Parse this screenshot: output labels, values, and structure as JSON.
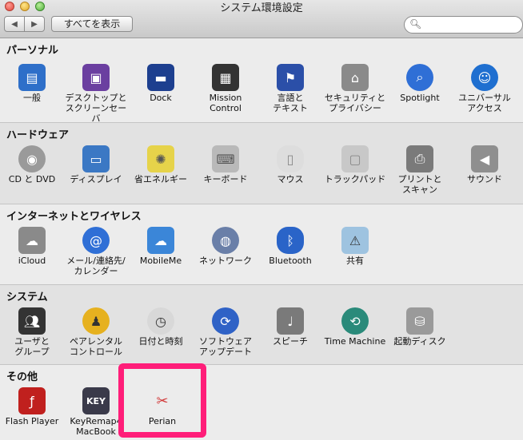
{
  "window": {
    "title": "システム環境設定"
  },
  "toolbar": {
    "back": "◀",
    "forward": "▶",
    "show_all": "すべてを表示",
    "search_placeholder": ""
  },
  "sections": [
    {
      "title": "パーソナル",
      "items": [
        {
          "label": "一般",
          "icon": "file-icon",
          "color": "#2e6fc9"
        },
        {
          "label": "デスクトップと\nスクリーンセーバ",
          "icon": "desktop-icon",
          "color": "#6b3fa0"
        },
        {
          "label": "Dock",
          "icon": "dock-icon",
          "color": "#1d3f8f"
        },
        {
          "label": "Mission\nControl",
          "icon": "mission-control-icon",
          "color": "#333333"
        },
        {
          "label": "言語と\nテキスト",
          "icon": "flag-icon",
          "color": "#2b4fa8"
        },
        {
          "label": "セキュリティと\nプライバシー",
          "icon": "house-lock-icon",
          "color": "#8a8a8a"
        },
        {
          "label": "Spotlight",
          "icon": "spotlight-icon",
          "color": "#2f6fd6"
        },
        {
          "label": "ユニバーサル\nアクセス",
          "icon": "accessibility-icon",
          "color": "#1f6fd0"
        }
      ]
    },
    {
      "title": "ハードウェア",
      "items": [
        {
          "label": "CD と DVD",
          "icon": "disc-icon",
          "color": "#9a9a9a"
        },
        {
          "label": "ディスプレイ",
          "icon": "display-icon",
          "color": "#3b78c4"
        },
        {
          "label": "省エネルギー",
          "icon": "bulb-icon",
          "color": "#e6d34a"
        },
        {
          "label": "キーボード",
          "icon": "keyboard-icon",
          "color": "#b9b9b9"
        },
        {
          "label": "マウス",
          "icon": "mouse-icon",
          "color": "#dddddd"
        },
        {
          "label": "トラックパッド",
          "icon": "trackpad-icon",
          "color": "#c8c8c8"
        },
        {
          "label": "プリントと\nスキャン",
          "icon": "printer-icon",
          "color": "#7a7a7a"
        },
        {
          "label": "サウンド",
          "icon": "speaker-icon",
          "color": "#8f8f8f"
        }
      ]
    },
    {
      "title": "インターネットとワイヤレス",
      "items": [
        {
          "label": "iCloud",
          "icon": "cloud-icon",
          "color": "#8a8a8a"
        },
        {
          "label": "メール/連絡先/\nカレンダー",
          "icon": "at-icon",
          "color": "#2f6fd6"
        },
        {
          "label": "MobileMe",
          "icon": "cloud-icon",
          "color": "#3b86d8"
        },
        {
          "label": "ネットワーク",
          "icon": "globe-icon",
          "color": "#6a7fa8"
        },
        {
          "label": "Bluetooth",
          "icon": "bluetooth-icon",
          "color": "#2a64c8"
        },
        {
          "label": "共有",
          "icon": "folder-icon",
          "color": "#9ec3e0"
        }
      ]
    },
    {
      "title": "システム",
      "items": [
        {
          "label": "ユーザと\nグループ",
          "icon": "users-icon",
          "color": "#333333"
        },
        {
          "label": "ペアレンタル\nコントロール",
          "icon": "parental-icon",
          "color": "#e6b11f"
        },
        {
          "label": "日付と時刻",
          "icon": "clock-icon",
          "color": "#d8d8d8"
        },
        {
          "label": "ソフトウェア\nアップデート",
          "icon": "update-icon",
          "color": "#2f62c6"
        },
        {
          "label": "スピーチ",
          "icon": "microphone-icon",
          "color": "#7a7a7a"
        },
        {
          "label": "Time Machine",
          "icon": "time-machine-icon",
          "color": "#2a8a7a"
        },
        {
          "label": "起動ディスク",
          "icon": "disk-icon",
          "color": "#9a9a9a"
        }
      ]
    },
    {
      "title": "その他",
      "items": [
        {
          "label": "Flash Player",
          "icon": "flash-icon",
          "color": "#c0201e"
        },
        {
          "label": "KeyRemap4\nMacBook",
          "icon": "key-icon",
          "color": "#3a3a4a"
        },
        {
          "label": "Perian",
          "icon": "perian-icon",
          "color": "#d23a3a"
        }
      ]
    }
  ]
}
